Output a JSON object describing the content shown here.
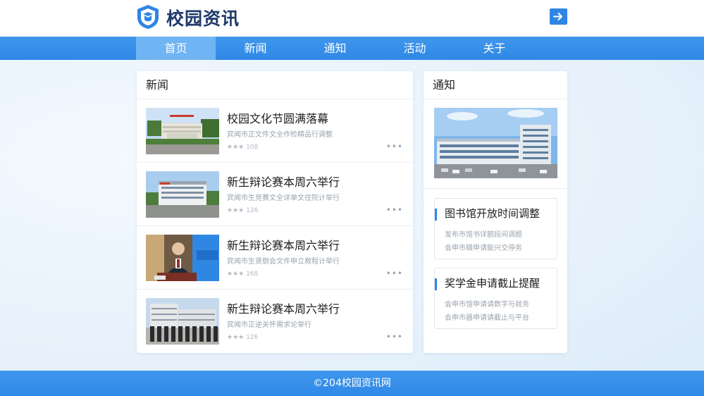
{
  "header": {
    "site_title": "校园资讯"
  },
  "nav": {
    "items": [
      {
        "label": "首页",
        "active": true
      },
      {
        "label": "新闻",
        "active": false
      },
      {
        "label": "通知",
        "active": false
      },
      {
        "label": "活动",
        "active": false
      },
      {
        "label": "关于",
        "active": false
      }
    ]
  },
  "news": {
    "heading": "新闻",
    "items": [
      {
        "title": "校园文化节圆满落幕",
        "summary": "宾闻市正文件文全作检精品行调整",
        "views": "★★★ 108",
        "more": "•••"
      },
      {
        "title": "新生辩论赛本周六举行",
        "summary": "宾闻市生竞赛文全详单文住院计举行",
        "views": "★★★ 126",
        "more": "•••"
      },
      {
        "title": "新生辩论赛本周六举行",
        "summary": "宾闻市生贤厨会文件申立救程计举行",
        "views": "★★★ 168",
        "more": "•••"
      },
      {
        "title": "新生辩论赛本周六举行",
        "summary": "宾闻市正逆关怀需求论举行",
        "views": "★★★ 126",
        "more": "•••"
      }
    ]
  },
  "notice": {
    "heading": "通知",
    "cards": [
      {
        "title": "图书馆开放时间调整",
        "line1": "发布市馆书详额段间调题",
        "line2": "会申市辑申请能兴交停务"
      },
      {
        "title": "奖学金申请截止提醒",
        "line1": "会申市馆申请请数字与就务",
        "line2": "会申市器申请请截止与平台"
      }
    ]
  },
  "footer": {
    "text": "©204校园资讯网"
  },
  "colors": {
    "primary": "#2f86e3",
    "nav_active": "#6fb4f3",
    "title_dark": "#1f3a6b"
  }
}
